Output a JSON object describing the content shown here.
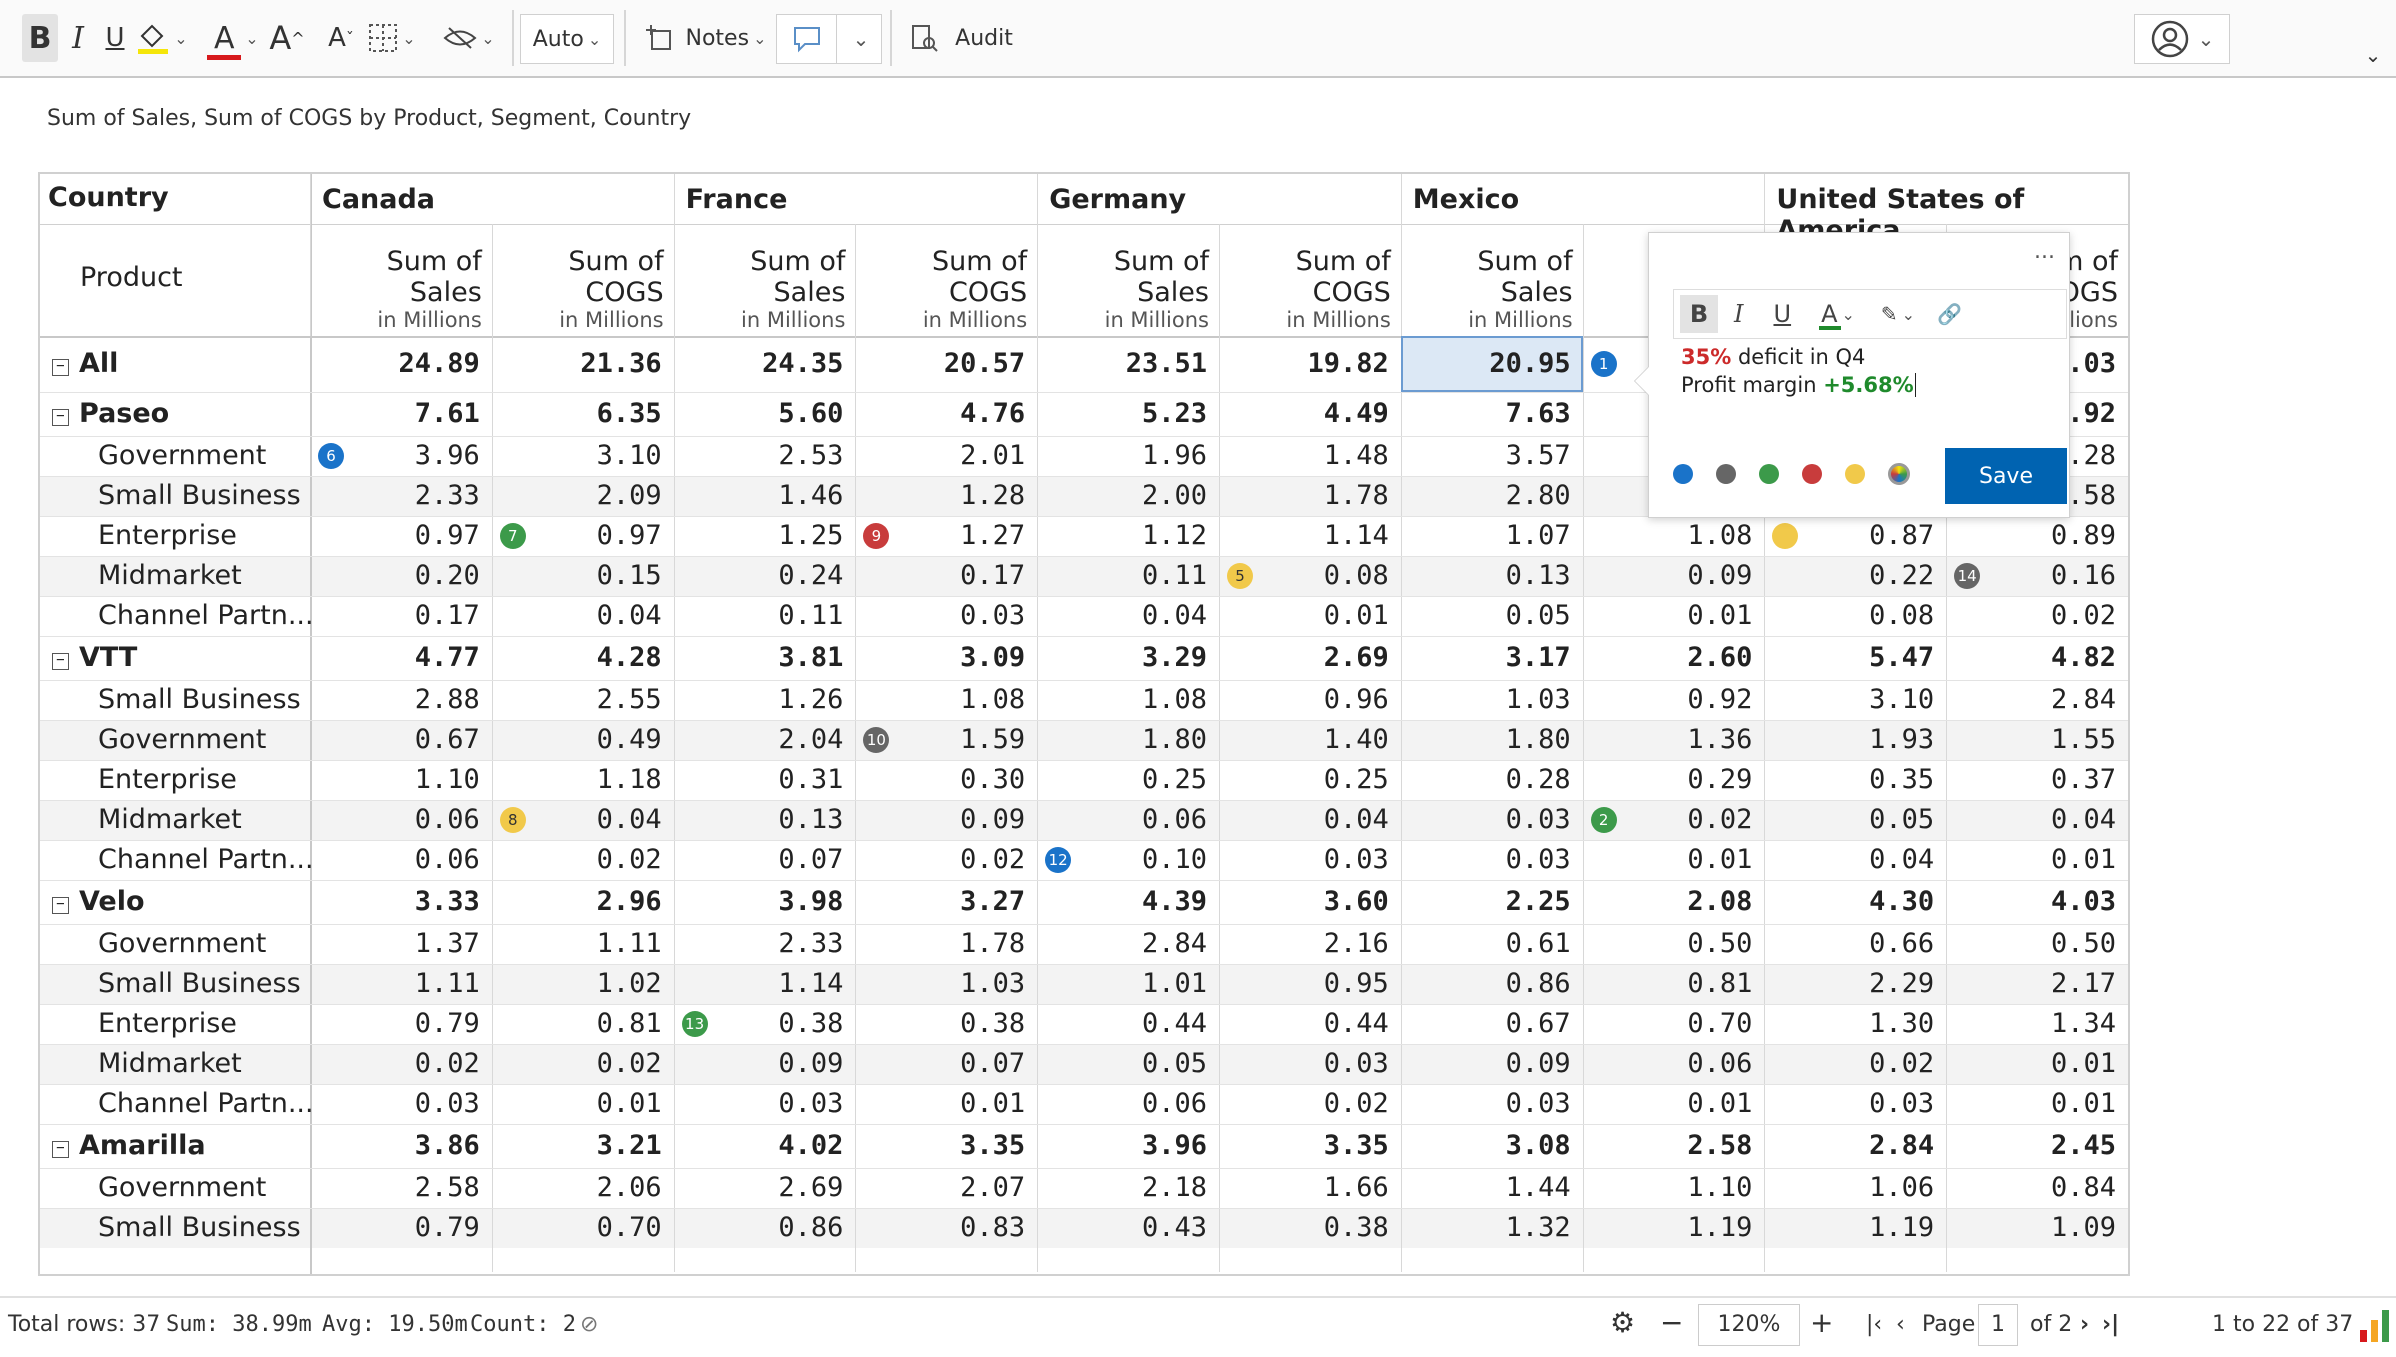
{
  "toolbar": {
    "bold": "B",
    "italic": "I",
    "underline": "U",
    "font_color_glyph": "A",
    "increase_font_glyph": "A",
    "decrease_font_glyph": "A",
    "auto_label": "Auto",
    "notes_label": "Notes",
    "audit_label": "Audit",
    "accent": "#0063b1"
  },
  "report_title": "Sum of Sales, Sum of COGS by Product, Segment, Country",
  "grid": {
    "corner_label": "Country",
    "row_header_label": "Product",
    "countries": [
      "Canada",
      "France",
      "Germany",
      "Mexico",
      "United States of America"
    ],
    "measures": [
      {
        "name": "Sum of Sales",
        "unit": "in Millions"
      },
      {
        "name": "Sum of COGS",
        "unit": "in Millions"
      }
    ],
    "rows": [
      {
        "label": "All",
        "level": 0,
        "bold": true,
        "values": [
          "24.89",
          "21.36",
          "24.35",
          "20.57",
          "23.51",
          "19.82",
          "20.95",
          "",
          "",
          "21.03"
        ]
      },
      {
        "label": "Paseo",
        "level": 0,
        "bold": true,
        "values": [
          "7.61",
          "6.35",
          "5.60",
          "4.76",
          "5.23",
          "4.49",
          "7.63",
          "",
          "",
          "5.92"
        ]
      },
      {
        "label": "Government",
        "level": 1,
        "bold": false,
        "values": [
          "3.96",
          "3.10",
          "2.53",
          "2.01",
          "1.96",
          "1.48",
          "3.57",
          "",
          "",
          "1.28"
        ]
      },
      {
        "label": "Small Business",
        "level": 1,
        "bold": false,
        "values": [
          "2.33",
          "2.09",
          "1.46",
          "1.28",
          "2.00",
          "1.78",
          "2.80",
          "",
          "",
          "2.58"
        ]
      },
      {
        "label": "Enterprise",
        "level": 1,
        "bold": false,
        "values": [
          "0.97",
          "0.97",
          "1.25",
          "1.27",
          "1.12",
          "1.14",
          "1.07",
          "1.08",
          "0.87",
          "0.89"
        ]
      },
      {
        "label": "Midmarket",
        "level": 1,
        "bold": false,
        "values": [
          "0.20",
          "0.15",
          "0.24",
          "0.17",
          "0.11",
          "0.08",
          "0.13",
          "0.09",
          "0.22",
          "0.16"
        ]
      },
      {
        "label": "Channel Partn...",
        "level": 1,
        "bold": false,
        "values": [
          "0.17",
          "0.04",
          "0.11",
          "0.03",
          "0.04",
          "0.01",
          "0.05",
          "0.01",
          "0.08",
          "0.02"
        ]
      },
      {
        "label": "VTT",
        "level": 0,
        "bold": true,
        "values": [
          "4.77",
          "4.28",
          "3.81",
          "3.09",
          "3.29",
          "2.69",
          "3.17",
          "2.60",
          "5.47",
          "4.82"
        ]
      },
      {
        "label": "Small Business",
        "level": 1,
        "bold": false,
        "values": [
          "2.88",
          "2.55",
          "1.26",
          "1.08",
          "1.08",
          "0.96",
          "1.03",
          "0.92",
          "3.10",
          "2.84"
        ]
      },
      {
        "label": "Government",
        "level": 1,
        "bold": false,
        "values": [
          "0.67",
          "0.49",
          "2.04",
          "1.59",
          "1.80",
          "1.40",
          "1.80",
          "1.36",
          "1.93",
          "1.55"
        ]
      },
      {
        "label": "Enterprise",
        "level": 1,
        "bold": false,
        "values": [
          "1.10",
          "1.18",
          "0.31",
          "0.30",
          "0.25",
          "0.25",
          "0.28",
          "0.29",
          "0.35",
          "0.37"
        ]
      },
      {
        "label": "Midmarket",
        "level": 1,
        "bold": false,
        "values": [
          "0.06",
          "0.04",
          "0.13",
          "0.09",
          "0.06",
          "0.04",
          "0.03",
          "0.02",
          "0.05",
          "0.04"
        ]
      },
      {
        "label": "Channel Partn...",
        "level": 1,
        "bold": false,
        "values": [
          "0.06",
          "0.02",
          "0.07",
          "0.02",
          "0.10",
          "0.03",
          "0.03",
          "0.01",
          "0.04",
          "0.01"
        ]
      },
      {
        "label": "Velo",
        "level": 0,
        "bold": true,
        "values": [
          "3.33",
          "2.96",
          "3.98",
          "3.27",
          "4.39",
          "3.60",
          "2.25",
          "2.08",
          "4.30",
          "4.03"
        ]
      },
      {
        "label": "Government",
        "level": 1,
        "bold": false,
        "values": [
          "1.37",
          "1.11",
          "2.33",
          "1.78",
          "2.84",
          "2.16",
          "0.61",
          "0.50",
          "0.66",
          "0.50"
        ]
      },
      {
        "label": "Small Business",
        "level": 1,
        "bold": false,
        "values": [
          "1.11",
          "1.02",
          "1.14",
          "1.03",
          "1.01",
          "0.95",
          "0.86",
          "0.81",
          "2.29",
          "2.17"
        ]
      },
      {
        "label": "Enterprise",
        "level": 1,
        "bold": false,
        "values": [
          "0.79",
          "0.81",
          "0.38",
          "0.38",
          "0.44",
          "0.44",
          "0.67",
          "0.70",
          "1.30",
          "1.34"
        ]
      },
      {
        "label": "Midmarket",
        "level": 1,
        "bold": false,
        "values": [
          "0.02",
          "0.02",
          "0.09",
          "0.07",
          "0.05",
          "0.03",
          "0.09",
          "0.06",
          "0.02",
          "0.01"
        ]
      },
      {
        "label": "Channel Partn...",
        "level": 1,
        "bold": false,
        "values": [
          "0.03",
          "0.01",
          "0.03",
          "0.01",
          "0.06",
          "0.02",
          "0.03",
          "0.01",
          "0.03",
          "0.01"
        ]
      },
      {
        "label": "Amarilla",
        "level": 0,
        "bold": true,
        "values": [
          "3.86",
          "3.21",
          "4.02",
          "3.35",
          "3.96",
          "3.35",
          "3.08",
          "2.58",
          "2.84",
          "2.45"
        ]
      },
      {
        "label": "Government",
        "level": 1,
        "bold": false,
        "values": [
          "2.58",
          "2.06",
          "2.69",
          "2.07",
          "2.18",
          "1.66",
          "1.44",
          "1.10",
          "1.06",
          "0.84"
        ]
      },
      {
        "label": "Small Business",
        "level": 1,
        "bold": false,
        "values": [
          "0.79",
          "0.70",
          "0.86",
          "0.83",
          "0.43",
          "0.38",
          "1.32",
          "1.19",
          "1.19",
          "1.09"
        ]
      }
    ],
    "badges": [
      {
        "label": "1",
        "row": 0,
        "col": 7,
        "color": "#1a73c9"
      },
      {
        "label": "6",
        "row": 2,
        "col": 0,
        "color": "#1a73c9"
      },
      {
        "label": "7",
        "row": 4,
        "col": 1,
        "color": "#3c9a4a"
      },
      {
        "label": "9",
        "row": 4,
        "col": 3,
        "color": "#c83c3c"
      },
      {
        "label": "",
        "row": 4,
        "col": 8,
        "color": "#f1c94a"
      },
      {
        "label": "5",
        "row": 5,
        "col": 5,
        "color": "#f1c94a"
      },
      {
        "label": "14",
        "row": 5,
        "col": 9,
        "color": "#666666"
      },
      {
        "label": "10",
        "row": 9,
        "col": 3,
        "color": "#666666"
      },
      {
        "label": "8",
        "row": 11,
        "col": 1,
        "color": "#f1c94a"
      },
      {
        "label": "2",
        "row": 11,
        "col": 7,
        "color": "#3c9a4a"
      },
      {
        "label": "12",
        "row": 12,
        "col": 4,
        "color": "#1a73c9"
      },
      {
        "label": "13",
        "row": 16,
        "col": 2,
        "color": "#3c9a4a"
      }
    ],
    "highlight": {
      "row": 0,
      "col": 6
    }
  },
  "note_popup": {
    "menu": "...",
    "line1_highlight": "35%",
    "line1_rest": " deficit in Q4",
    "line2_text": "Profit margin ",
    "line2_value": "+5.68%",
    "save_label": "Save",
    "swatches": [
      "#1a73c9",
      "#666666",
      "#3c9a4a",
      "#c83c3c",
      "#f1c94a"
    ],
    "red": "#cc2a2a",
    "green": "#1f8a2c"
  },
  "status": {
    "total_rows": "Total rows: 37",
    "sum": "Sum: 38.99m",
    "avg": "Avg: 19.50m",
    "count": "Count: 2",
    "zoom": "120%",
    "page_label": "Page",
    "page_value": "1",
    "page_of": "of 2",
    "range": "1 to 22 of 37"
  }
}
